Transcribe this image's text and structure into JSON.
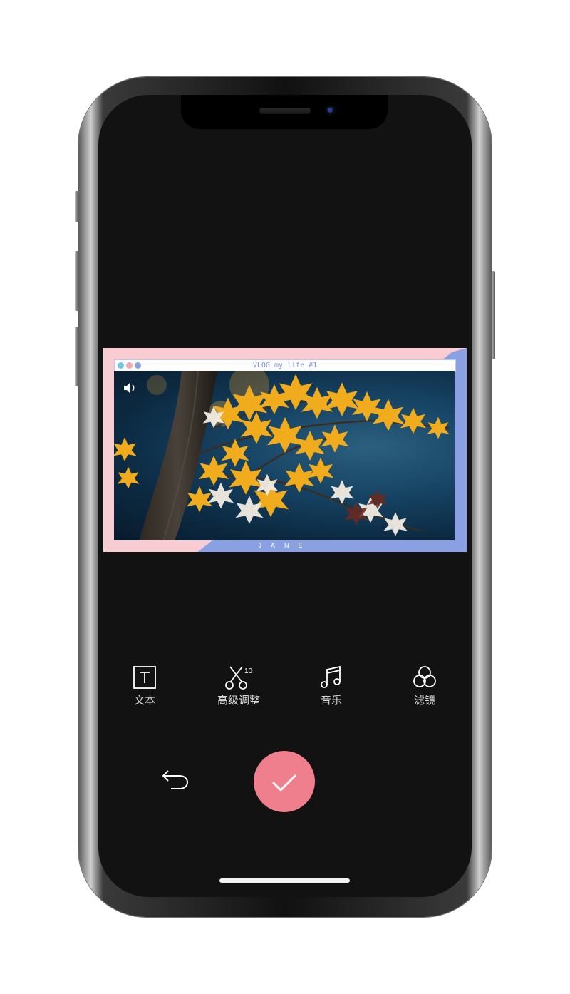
{
  "colors": {
    "accent": "#ef7f8c",
    "frame_pink": "#f7ccd3",
    "frame_blue": "#8aa0e2",
    "window_dots": [
      "#74c7d6",
      "#f2a9b6",
      "#8aa0e2"
    ]
  },
  "preview": {
    "window_title": "VLOG my life #1",
    "caption": "JANE",
    "volume_icon": "speaker-icon"
  },
  "toolbar": {
    "items": [
      {
        "label": "文本",
        "icon": "text-box-icon"
      },
      {
        "label": "高级调整",
        "icon": "scissors-icon",
        "badge": "10s"
      },
      {
        "label": "音乐",
        "icon": "music-note-icon"
      },
      {
        "label": "滤镜",
        "icon": "three-circles-icon"
      }
    ]
  },
  "actions": {
    "back_icon": "undo-arrow-icon",
    "confirm_icon": "checkmark-icon"
  }
}
